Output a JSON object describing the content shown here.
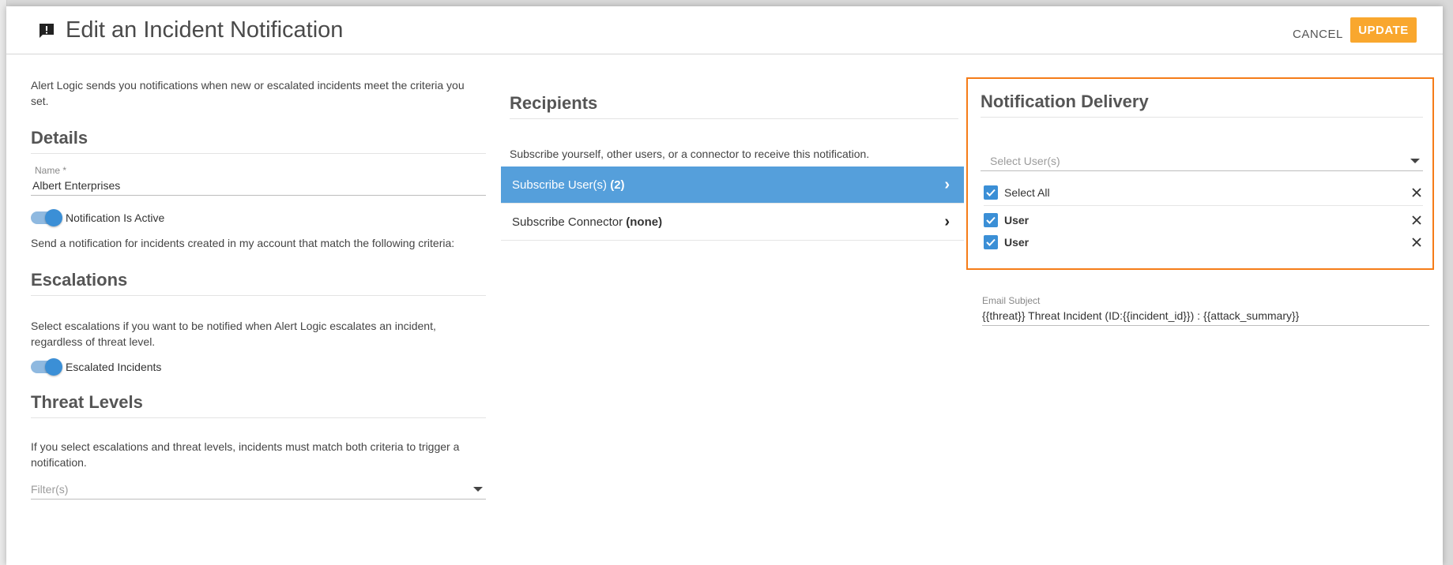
{
  "header": {
    "title": "Edit an Incident Notification",
    "cancel_label": "CANCEL",
    "update_label": "UPDATE",
    "icon": "alert-message-icon"
  },
  "left": {
    "intro": "Alert Logic sends you notifications when new or escalated incidents meet the criteria you set.",
    "details_title": "Details",
    "name_label": "Name *",
    "name_value": "Albert Enterprises",
    "active_toggle_label": "Notification Is Active",
    "criteria_text": "Send a notification for incidents created in my account that match the following criteria:",
    "escalations_title": "Escalations",
    "escalations_text": "Select escalations if you want to be notified when Alert Logic escalates an incident, regardless of threat level.",
    "escalated_toggle_label": "Escalated Incidents",
    "threat_title": "Threat Levels",
    "threat_text": "If you select escalations and threat levels, incidents must match both criteria to trigger a notification.",
    "filter_placeholder": "Filter(s)"
  },
  "middle": {
    "recipients_title": "Recipients",
    "subscribe_text": "Subscribe yourself, other users, or a connector to receive this notification.",
    "subscribe_users_label": "Subscribe User(s) ",
    "subscribe_users_count": "(2)",
    "subscribe_connector_label": "Subscribe Connector ",
    "subscribe_connector_value": "(none)"
  },
  "right": {
    "delivery_title": "Notification Delivery",
    "select_users_placeholder": "Select User(s)",
    "select_all_label": "Select All",
    "users": [
      "User",
      "User"
    ],
    "email_subject_label": "Email Subject",
    "email_subject_value": "{{threat}} Threat Incident (ID:{{incident_id}}) : {{attack_summary}}"
  },
  "colors": {
    "accent": "#f9a72e",
    "primary_blue": "#559fdb",
    "highlight_border": "#f57c18"
  }
}
